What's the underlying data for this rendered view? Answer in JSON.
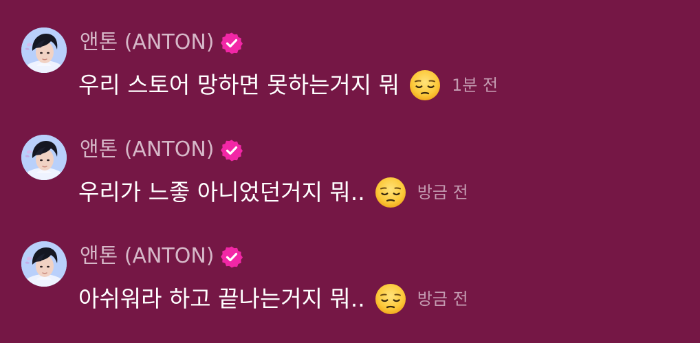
{
  "colors": {
    "background": "#751745",
    "sender_name": "#d6b8c8",
    "message_text": "#ffffff",
    "timestamp": "#c49bb1",
    "verified_badge": "#f227a6"
  },
  "messages": [
    {
      "sender": "앤톤 (ANTON)",
      "verified_icon": "verified-badge-icon",
      "text": "우리 스토어 망하면 못하는거지 뭐",
      "emoji": "pensive-face-emoji",
      "timestamp": "1분 전"
    },
    {
      "sender": "앤톤 (ANTON)",
      "verified_icon": "verified-badge-icon",
      "text": "우리가 느좋 아니었던거지 뭐..",
      "emoji": "pensive-face-emoji",
      "timestamp": "방금 전"
    },
    {
      "sender": "앤톤 (ANTON)",
      "verified_icon": "verified-badge-icon",
      "text": "아쉬워라 하고 끝나는거지 뭐..",
      "emoji": "pensive-face-emoji",
      "timestamp": "방금 전"
    }
  ]
}
